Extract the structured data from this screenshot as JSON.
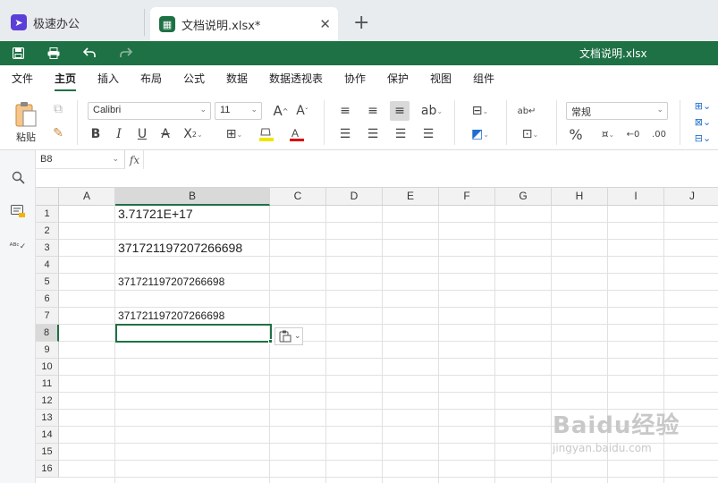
{
  "tabs": [
    {
      "label": "极速办公"
    },
    {
      "label": "文档说明.xlsx*"
    }
  ],
  "new_tab_label": "+",
  "close_label": "✕",
  "quickbar": {
    "doc_title": "文档说明.xlsx"
  },
  "menu": [
    "文件",
    "主页",
    "插入",
    "布局",
    "公式",
    "数据",
    "数据透视表",
    "协作",
    "保护",
    "视图",
    "组件"
  ],
  "ribbon": {
    "paste_label": "粘贴",
    "font_name": "Calibri",
    "font_size": "11",
    "number_format": "常规",
    "bold": "B",
    "italic": "I",
    "underline": "U",
    "percent": "%"
  },
  "formula_bar": {
    "cell_ref": "B8",
    "fx": "fx",
    "content": ""
  },
  "columns": [
    "A",
    "B",
    "C",
    "D",
    "E",
    "F",
    "G",
    "H",
    "I",
    "J"
  ],
  "rows": [
    "1",
    "2",
    "3",
    "4",
    "5",
    "6",
    "7",
    "8",
    "9",
    "10",
    "11",
    "12",
    "13",
    "14",
    "15",
    "16"
  ],
  "cells": {
    "B1": "3.71721E+17",
    "B3": "371721197207266698",
    "B5": "371721197207266698",
    "B7": "371721197207266698"
  },
  "selected": {
    "column": "B",
    "row": "8"
  },
  "watermark": {
    "brand": "Baidu经验",
    "url": "jingyan.baidu.com"
  },
  "colors": {
    "accent": "#1e7145",
    "launcher": "#5b3fd6"
  }
}
